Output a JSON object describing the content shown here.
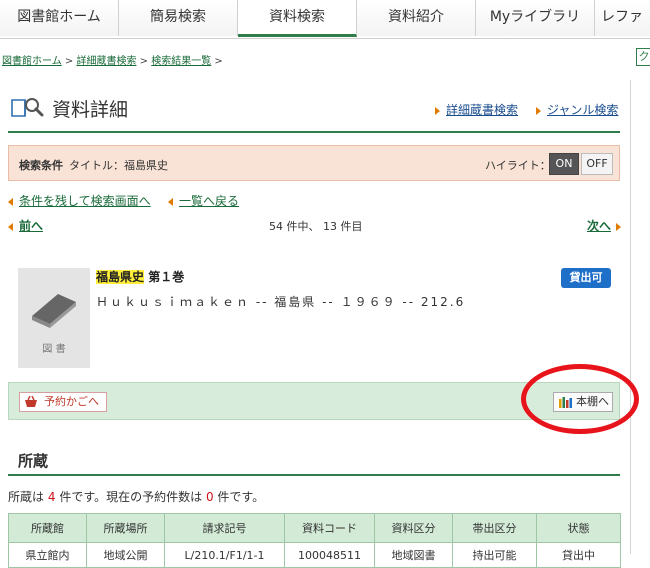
{
  "nav": {
    "tabs": [
      {
        "label": "図書館ホーム"
      },
      {
        "label": "簡易検索"
      },
      {
        "label": "資料検索"
      },
      {
        "label": "資料紹介"
      },
      {
        "label": "Myライブラリ"
      },
      {
        "label": "レファ"
      }
    ]
  },
  "breadcrumb": {
    "items": [
      "図書館ホーム",
      "詳細蔵書検索",
      "検索結果一覧"
    ],
    "separator": ">"
  },
  "page": {
    "title": "資料詳細",
    "links": [
      "詳細蔵書検索",
      "ジャンル検索"
    ]
  },
  "condition": {
    "label": "検索条件",
    "value": "タイトル：福島県史",
    "highlight_label": "ハイライト：",
    "on": "ON",
    "off": "OFF"
  },
  "navlinks": {
    "back_search": "条件を残して検索画面へ",
    "back_list": "一覧へ戻る",
    "prev": "前へ",
    "next": "次へ",
    "count": "54 件中、 13 件目"
  },
  "record": {
    "title_highlight": "福島県史",
    "title_rest": " 第１巻",
    "subtitle": "Ｈｕｋｕｓｉｍａｋｅｎ -- 福島県 -- １９６９ -- 212.6",
    "cover_label": "図 書",
    "badge": "貸出可",
    "cart_button": "予約かごへ",
    "shelf_button": "本棚へ"
  },
  "holdings": {
    "title": "所蔵",
    "summary_prefix": "所蔵は",
    "count": "4",
    "summary_mid": "件です。現在の予約件数は",
    "reserve": "0",
    "summary_suffix": "件です。",
    "columns": [
      "所蔵館",
      "所蔵場所",
      "請求記号",
      "資料コード",
      "資料区分",
      "帯出区分",
      "状態"
    ],
    "row": [
      "県立館内",
      "地域公開",
      "L/210.1/F1/1-1",
      "100048511",
      "地域図書",
      "持出可能",
      "貸出中"
    ]
  },
  "colors": {
    "accent_green": "#2f7d4a",
    "badge_blue": "#1e6fc8",
    "annotation_red": "#e8141c",
    "highlight_yellow": "#ffef3a"
  }
}
